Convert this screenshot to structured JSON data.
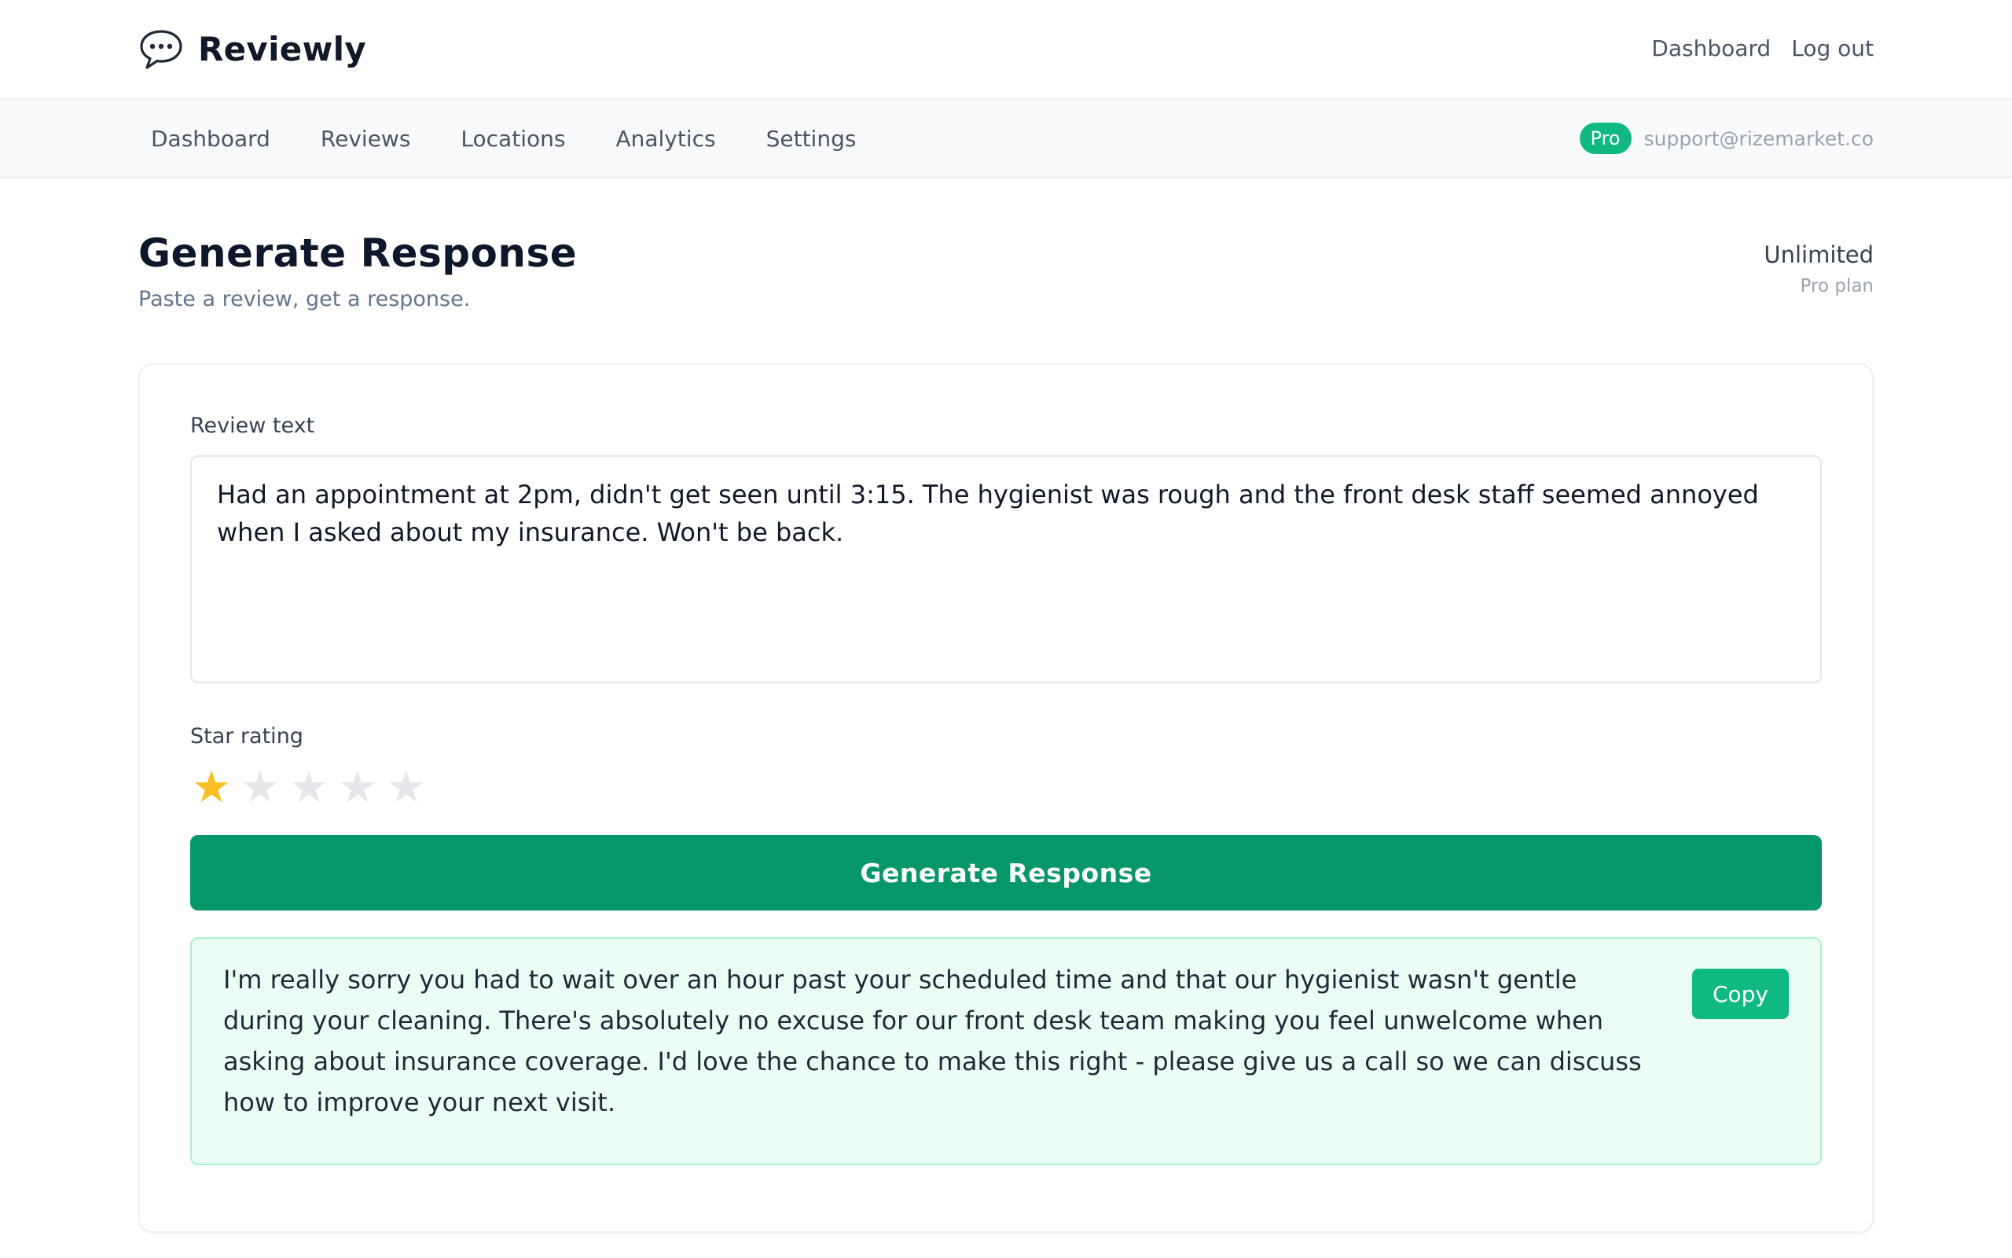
{
  "brand": {
    "name": "Reviewly",
    "icon": "speech-bubble-icon"
  },
  "header": {
    "links": [
      "Dashboard",
      "Log out"
    ]
  },
  "nav": {
    "items": [
      "Dashboard",
      "Reviews",
      "Locations",
      "Analytics",
      "Settings"
    ],
    "badge": "Pro",
    "email": "support@rizemarket.co"
  },
  "page": {
    "title": "Generate Response",
    "subtitle": "Paste a review, get a response.",
    "plan_value": "Unlimited",
    "plan_label": "Pro plan"
  },
  "form": {
    "review_label": "Review text",
    "review_text": "Had an appointment at 2pm, didn't get seen until 3:15. The hygienist was rough and the front desk staff seemed annoyed when I asked about my insurance. Won't be back.",
    "rating_label": "Star rating",
    "rating": 1,
    "rating_max": 5,
    "generate_label": "Generate Response"
  },
  "result": {
    "text": "I'm really sorry you had to wait over an hour past your scheduled time and that our hygienist wasn't gentle during your cleaning. There's absolutely no excuse for our front desk team making you feel unwelcome when asking about insurance coverage. I'd love the chance to make this right - please give us a call so we can discuss how to improve your next visit.",
    "copy_label": "Copy"
  },
  "colors": {
    "accent": "#059669",
    "badge": "#10b981",
    "star_on": "#fbbf24",
    "star_off": "#e5e7eb",
    "result_bg": "#ecfdf5"
  }
}
